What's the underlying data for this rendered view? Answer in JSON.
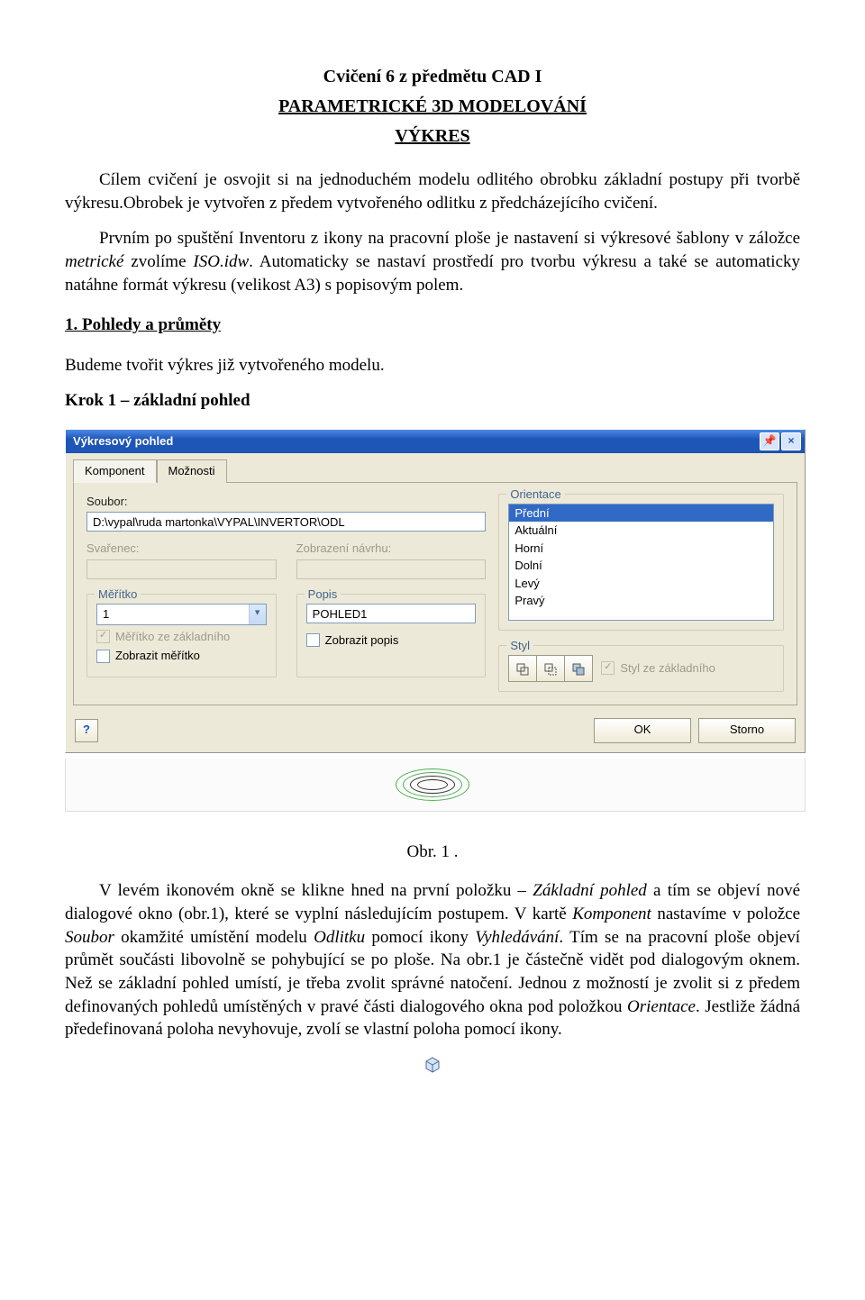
{
  "doc": {
    "title": "Cvičení 6 z předmětu CAD I",
    "subtitle": "PARAMETRICKÉ  3D MODELOVÁNÍ",
    "subtitle2": "VÝKRES",
    "intro1": "Cílem cvičení je osvojit si na jednoduchém modelu odlitého obrobku základní postupy při tvorbě výkresu.Obrobek je vytvořen z předem vytvořeného odlitku z předcházejícího cvičení.",
    "intro2a": "Prvním po spuštění Inventoru z ikony na pracovní ploše je nastavení si výkresové šablony v záložce ",
    "intro2_em": "metrické",
    "intro2b": " zvolíme ",
    "intro2_em2": "ISO.idw",
    "intro2c": ". Automaticky se nastaví prostředí pro tvorbu výkresu a také se automaticky natáhne formát výkresu (velikost A3) s popisovým polem.",
    "section1_num": "1.  ",
    "section1_title": "Pohledy a průměty",
    "section1_body": "Budeme tvořit výkres již vytvořeného modelu.",
    "step1": "Krok 1 – základní pohled",
    "fig1": "Obr. 1 .",
    "p3a": "V levém ikonovém okně se klikne hned na první položku – ",
    "p3_em1": "Základní pohled",
    "p3b": " a tím se objeví nové dialogové okno (obr.1), které se vyplní následujícím postupem. V kartě ",
    "p3_em2": "Komponent",
    "p3c": " nastavíme v položce ",
    "p3_em3": "Soubor",
    "p3d": " okamžité umístění modelu ",
    "p3_em4": "Odlitku",
    "p3e": " pomocí ikony ",
    "p3_em5": "Vyhledávání",
    "p3f": ". Tím se na pracovní ploše objeví průmět součásti libovolně se pohybující se po ploše. Na obr.1 je částečně vidět pod dialogovým oknem. Než se základní pohled umístí, je třeba zvolit správné natočení. Jednou z možností je zvolit si z předem definovaných pohledů umístěných v pravé části dialogového okna pod položkou ",
    "p3_em6": "Orientace",
    "p3g": ". Jestliže žádná předefinovaná poloha nevyhovuje, zvolí se vlastní poloha pomocí ikony."
  },
  "dialog": {
    "title": "Výkresový pohled",
    "tabs": {
      "komponent": "Komponent",
      "moznosti": "Možnosti"
    },
    "labels": {
      "soubor": "Soubor:",
      "svarenec": "Svařenec:",
      "zobrazeni": "Zobrazení návrhu:",
      "orientace": "Orientace",
      "meritko": "Měřítko",
      "popis": "Popis",
      "styl": "Styl"
    },
    "file_value": "D:\\vypal\\ruda martonka\\VYPAL\\INVERTOR\\ODL",
    "orient_opts": [
      "Přední",
      "Aktuální",
      "Horní",
      "Dolní",
      "Levý",
      "Pravý"
    ],
    "meritko_value": "1",
    "popis_value": "POHLED1",
    "cb": {
      "meritko_zakl": "Měřítko ze základního",
      "zobrazit_meritko": "Zobrazit měřítko",
      "zobrazit_popis": "Zobrazit popis",
      "styl_zakl": "Styl ze základního"
    },
    "buttons": {
      "ok": "OK",
      "storno": "Storno"
    }
  }
}
